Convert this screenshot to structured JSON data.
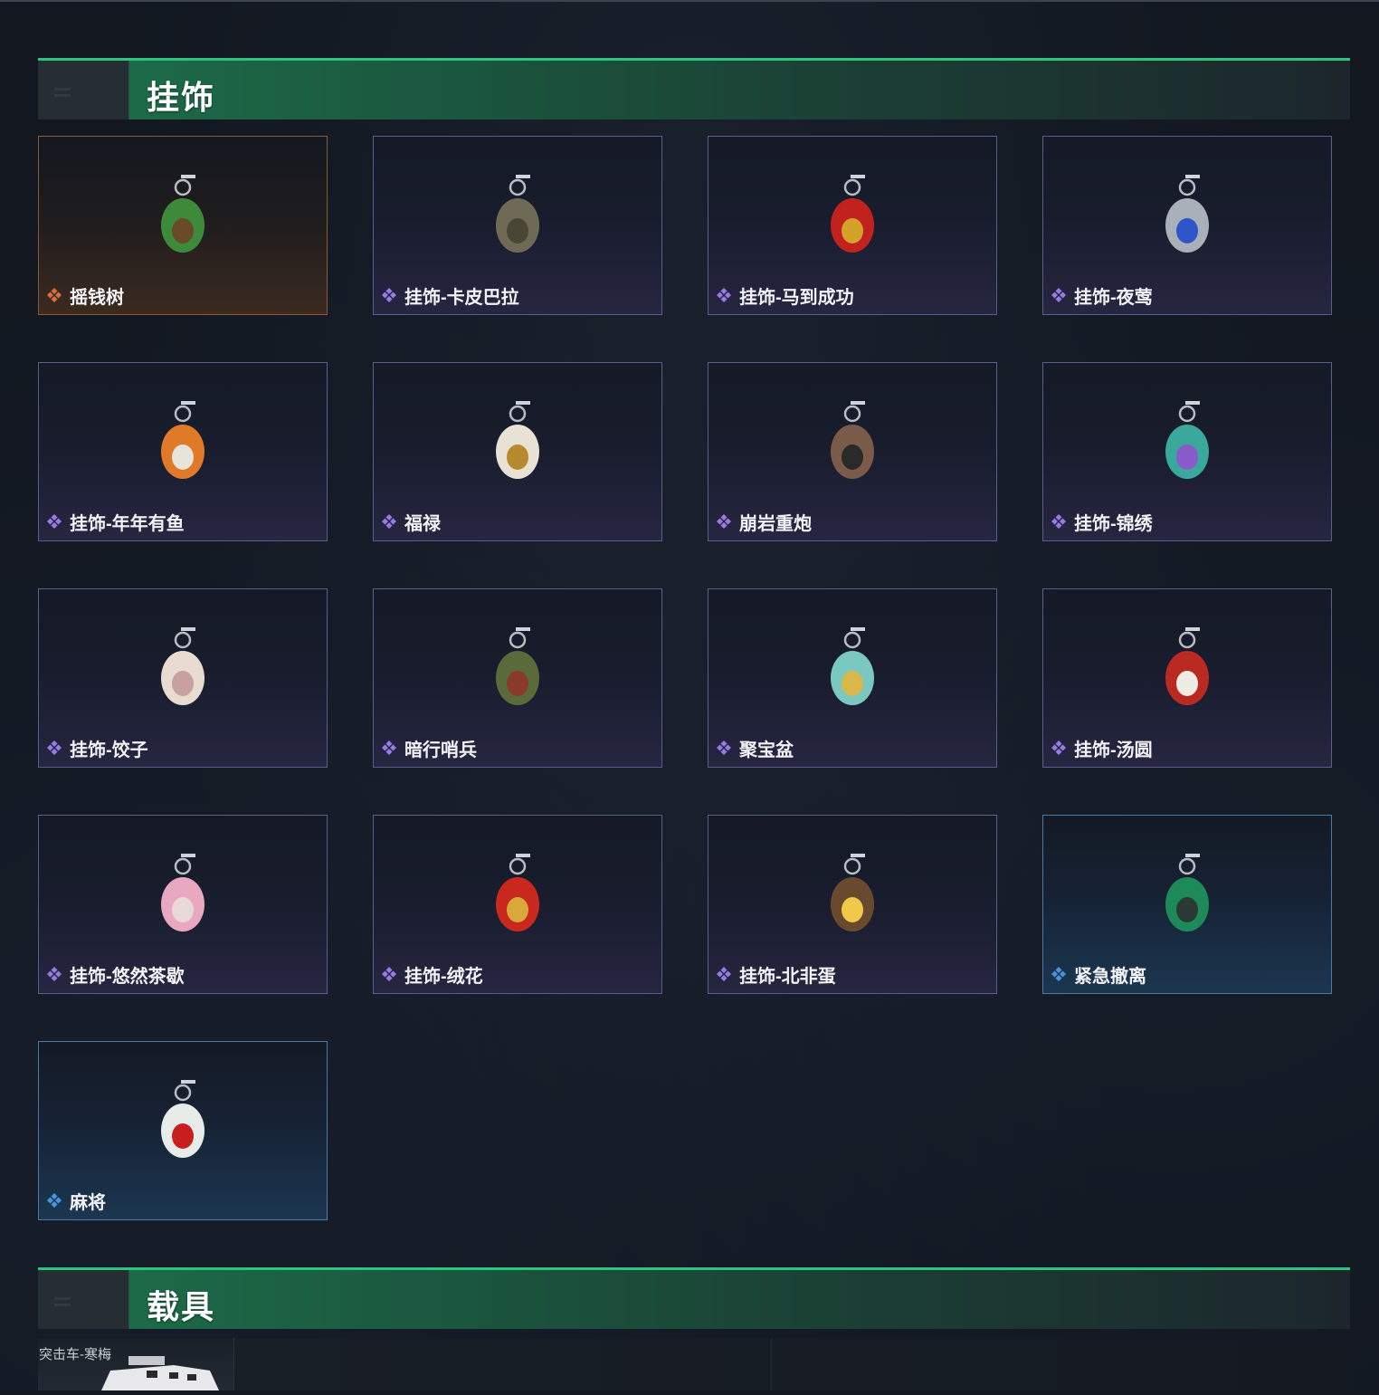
{
  "sections": {
    "charms": {
      "title": "挂饰"
    },
    "vehicles": {
      "title": "载具"
    }
  },
  "rarity_colors": {
    "orange": "#d9713a",
    "purple": "#9a7be6",
    "blue": "#4a96de"
  },
  "items": [
    {
      "name": "摇钱树",
      "rarity": "orange",
      "icon": "money-tree-charm-icon"
    },
    {
      "name": "挂饰-卡皮巴拉",
      "rarity": "purple",
      "icon": "capybara-charm-icon"
    },
    {
      "name": "挂饰-马到成功",
      "rarity": "purple",
      "icon": "red-horse-charm-icon"
    },
    {
      "name": "挂饰-夜莺",
      "rarity": "purple",
      "icon": "nightingale-feather-charm-icon"
    },
    {
      "name": "挂饰-年年有鱼",
      "rarity": "purple",
      "icon": "fish-plate-charm-icon"
    },
    {
      "name": "福禄",
      "rarity": "purple",
      "icon": "gourd-charm-icon"
    },
    {
      "name": "崩岩重炮",
      "rarity": "purple",
      "icon": "heavy-cannon-figure-charm-icon"
    },
    {
      "name": "挂饰-锦绣",
      "rarity": "purple",
      "icon": "butterfly-charm-icon"
    },
    {
      "name": "挂饰-饺子",
      "rarity": "purple",
      "icon": "dumplings-charm-icon"
    },
    {
      "name": "暗行哨兵",
      "rarity": "purple",
      "icon": "sentinel-figure-charm-icon"
    },
    {
      "name": "聚宝盆",
      "rarity": "purple",
      "icon": "treasure-bowl-charm-icon"
    },
    {
      "name": "挂饰-汤圆",
      "rarity": "purple",
      "icon": "tangyuan-bowl-charm-icon"
    },
    {
      "name": "挂饰-悠然茶歇",
      "rarity": "purple",
      "icon": "cupcake-charm-icon"
    },
    {
      "name": "挂饰-绒花",
      "rarity": "purple",
      "icon": "velvet-flower-charm-icon"
    },
    {
      "name": "挂饰-北非蛋",
      "rarity": "purple",
      "icon": "shakshuka-pan-charm-icon"
    },
    {
      "name": "紧急撤离",
      "rarity": "blue",
      "icon": "emergency-exit-sign-charm-icon"
    },
    {
      "name": "麻将",
      "rarity": "blue",
      "icon": "mahjong-tile-charm-icon"
    }
  ],
  "vehicle_preview": {
    "name": "突击车-寒梅"
  }
}
